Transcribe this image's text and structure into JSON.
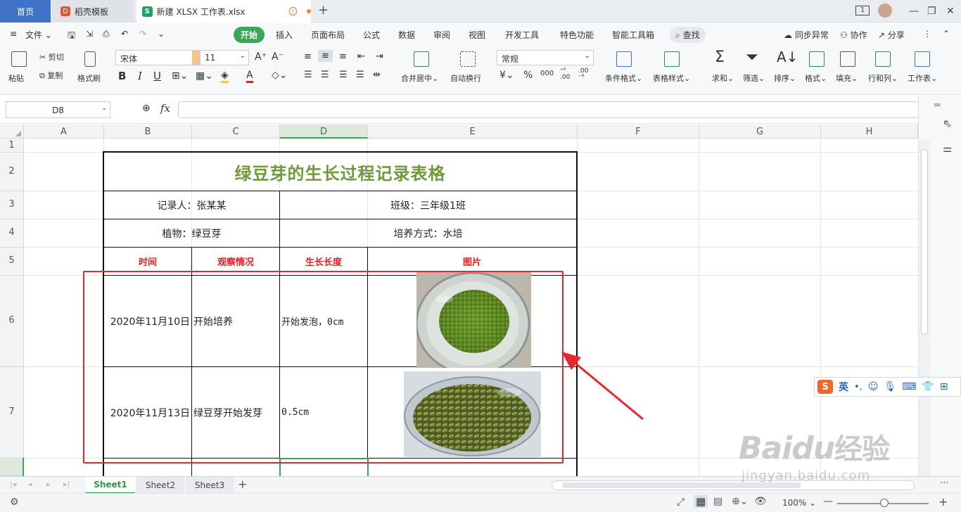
{
  "tabs": {
    "home": "首页",
    "template": "稻壳模板",
    "document": "新建 XLSX 工作表.xlsx",
    "window_badge": "1"
  },
  "menu": {
    "file": "文件",
    "items": [
      "开始",
      "插入",
      "页面布局",
      "公式",
      "数据",
      "审阅",
      "视图",
      "开发工具",
      "特色功能",
      "智能工具箱"
    ],
    "search": "查找",
    "sync": "同步异常",
    "collab": "协作",
    "share": "分享"
  },
  "toolbar": {
    "paste": "粘贴",
    "cut": "剪切",
    "copy": "复制",
    "format_painter": "格式刷",
    "font_name": "宋体",
    "font_size": "11",
    "merge_center": "合并居中",
    "wrap_text": "自动换行",
    "number_format": "常规",
    "cond_format": "条件格式",
    "table_style": "表格样式",
    "sum": "求和",
    "filter": "筛选",
    "sort": "排序",
    "format": "格式",
    "fill": "填充",
    "row_col": "行和列",
    "worksheet": "工作表"
  },
  "formula_bar": {
    "cell_ref": "D8",
    "fx": "fx",
    "value": ""
  },
  "columns": [
    "A",
    "B",
    "C",
    "D",
    "E",
    "F",
    "G",
    "H"
  ],
  "rows": [
    "1",
    "2",
    "3",
    "4",
    "5",
    "6",
    "7"
  ],
  "table": {
    "title": "绿豆芽的生长过程记录表格",
    "recorder": "记录人：张某某",
    "class": "班级：三年级1班",
    "plant": "植物：绿豆芽",
    "method": "培养方式：水培",
    "headers": [
      "时间",
      "观察情况",
      "生长长度",
      "图片"
    ],
    "records": [
      {
        "date": "2020年11月10日",
        "observation": "开始培养",
        "length": "开始发泡，0cm"
      },
      {
        "date": "2020年11月13日",
        "observation": "绿豆芽开始发芽",
        "length": "0.5cm"
      }
    ]
  },
  "sheets": [
    "Sheet1",
    "Sheet2",
    "Sheet3"
  ],
  "status": {
    "zoom": "100%"
  },
  "ime": {
    "lang": "英"
  },
  "watermark": {
    "brand": "Baidu",
    "brand_cn": "经验",
    "url": "jingyan.baidu.com"
  },
  "colors": {
    "accent_green": "#3aa757",
    "title_green": "#6e9a3a",
    "header_red": "#ee1c1c",
    "annotation_red": "#e8282a",
    "tab_blue": "#3f73c8"
  }
}
